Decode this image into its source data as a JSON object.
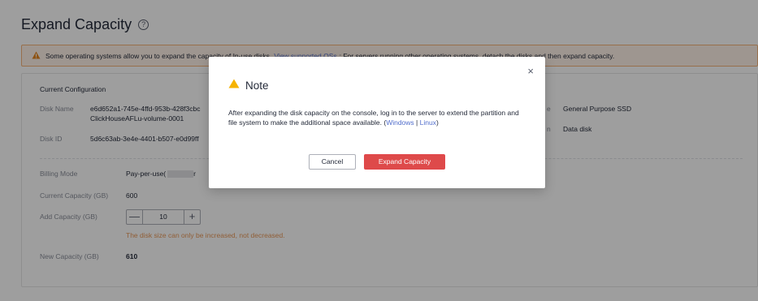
{
  "page": {
    "title": "Expand Capacity",
    "help_icon": "question-circle-icon"
  },
  "banner": {
    "text_before": "Some operating systems allow you to expand the capacity of In-use disks.",
    "link": "View supported OSs",
    "text_after": "; For servers running other operating systems, detach the disks and then expand capacity.",
    "icon": "warning-triangle-icon",
    "accent": "#f5b47a"
  },
  "config": {
    "title": "Current Configuration",
    "disk_name_label": "Disk Name",
    "disk_name_line1": "e6d652a1-745e-4ffd-953b-428f3cbc",
    "disk_name_line2": "ClickHouseAFLu-volume-0001",
    "disk_id_label": "Disk ID",
    "disk_id_value": "5d6c63ab-3e4e-4401-b507-e0d99ff",
    "type_label_fragment": "e",
    "type_value": "General Purpose SSD",
    "function_label_fragment": "n",
    "function_value": "Data disk",
    "billing_label": "Billing Mode",
    "billing_value": "Pay-per-use(",
    "billing_tail": "r",
    "current_capacity_label": "Current Capacity (GB)",
    "current_capacity_value": "600",
    "add_capacity_label": "Add Capacity (GB)",
    "add_capacity_value": "10",
    "minus": "—",
    "plus": "+",
    "hint": "The disk size can only be increased, not decreased.",
    "new_capacity_label": "New Capacity (GB)",
    "new_capacity_value": "610"
  },
  "modal": {
    "title": "Note",
    "close": "×",
    "body": "After expanding the disk capacity on the console, log in to the server to extend the partition and file system to make the additional space available. (",
    "link_windows": "Windows",
    "separator": " | ",
    "link_linux": "Linux",
    "body_end": ")",
    "cancel_label": "Cancel",
    "confirm_label": "Expand Capacity",
    "warning_color": "#f6b300",
    "primary_color": "#de4a4a"
  }
}
